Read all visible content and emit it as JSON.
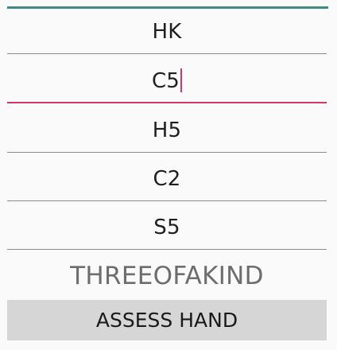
{
  "cards": [
    {
      "value": "HK",
      "focused": false
    },
    {
      "value": "C5",
      "focused": true
    },
    {
      "value": "H5",
      "focused": false
    },
    {
      "value": "C2",
      "focused": false
    },
    {
      "value": "S5",
      "focused": false
    }
  ],
  "result": {
    "text": "THREEOFAKIND"
  },
  "actions": {
    "assess_label": "ASSESS HAND"
  },
  "colors": {
    "top_accent": "#3c8a80",
    "focus_accent": "#d8336e",
    "button_bg": "#d6d6d6",
    "result_text": "#6d6d6d"
  }
}
